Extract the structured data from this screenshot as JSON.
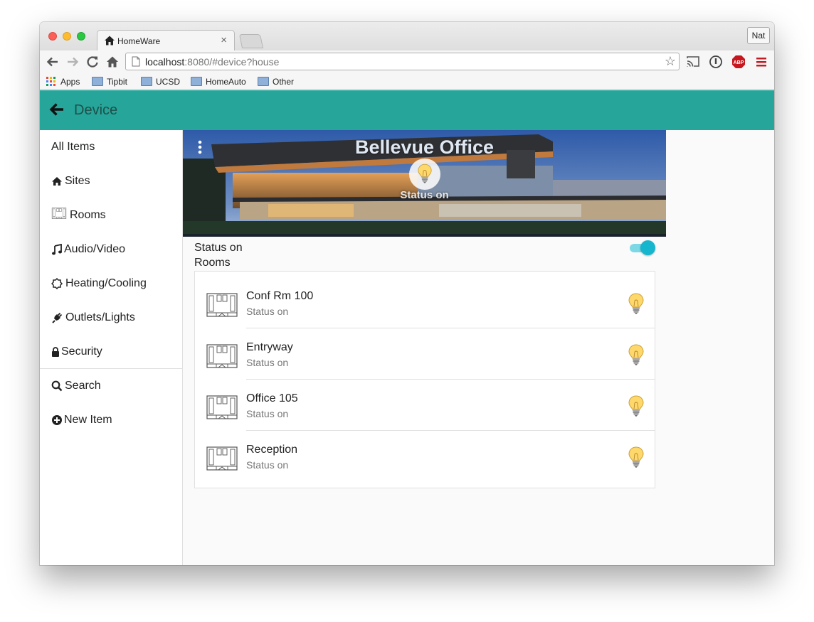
{
  "browser": {
    "tab_title": "HomeWare",
    "tab_close": "×",
    "profile": "Nat",
    "url_host": "localhost",
    "url_rest": ":8080/#device?house",
    "bookmarks": [
      {
        "label": "Apps"
      },
      {
        "label": "Tipbit"
      },
      {
        "label": "UCSD"
      },
      {
        "label": "HomeAuto"
      },
      {
        "label": "Other"
      }
    ]
  },
  "appbar": {
    "title": "Device"
  },
  "sidebar": {
    "items": [
      {
        "label": "All Items"
      },
      {
        "label": "Sites"
      },
      {
        "label": "Rooms"
      },
      {
        "label": "Audio/Video"
      },
      {
        "label": "Heating/Cooling"
      },
      {
        "label": "Outlets/Lights"
      },
      {
        "label": "Security"
      },
      {
        "label": "Search"
      },
      {
        "label": "New Item"
      }
    ]
  },
  "hero": {
    "title": "Bellevue Office",
    "status": "Status on"
  },
  "device": {
    "status": "Status on",
    "status_on": true,
    "rooms_label": "Rooms"
  },
  "rooms": [
    {
      "name": "Conf Rm 100",
      "status": "Status on"
    },
    {
      "name": "Entryway",
      "status": "Status on"
    },
    {
      "name": "Office 105",
      "status": "Status on"
    },
    {
      "name": "Reception",
      "status": "Status on"
    }
  ],
  "colors": {
    "primary": "#26a69a",
    "toggle": "#17b6cf",
    "toggle_track": "#7dd8e6"
  }
}
